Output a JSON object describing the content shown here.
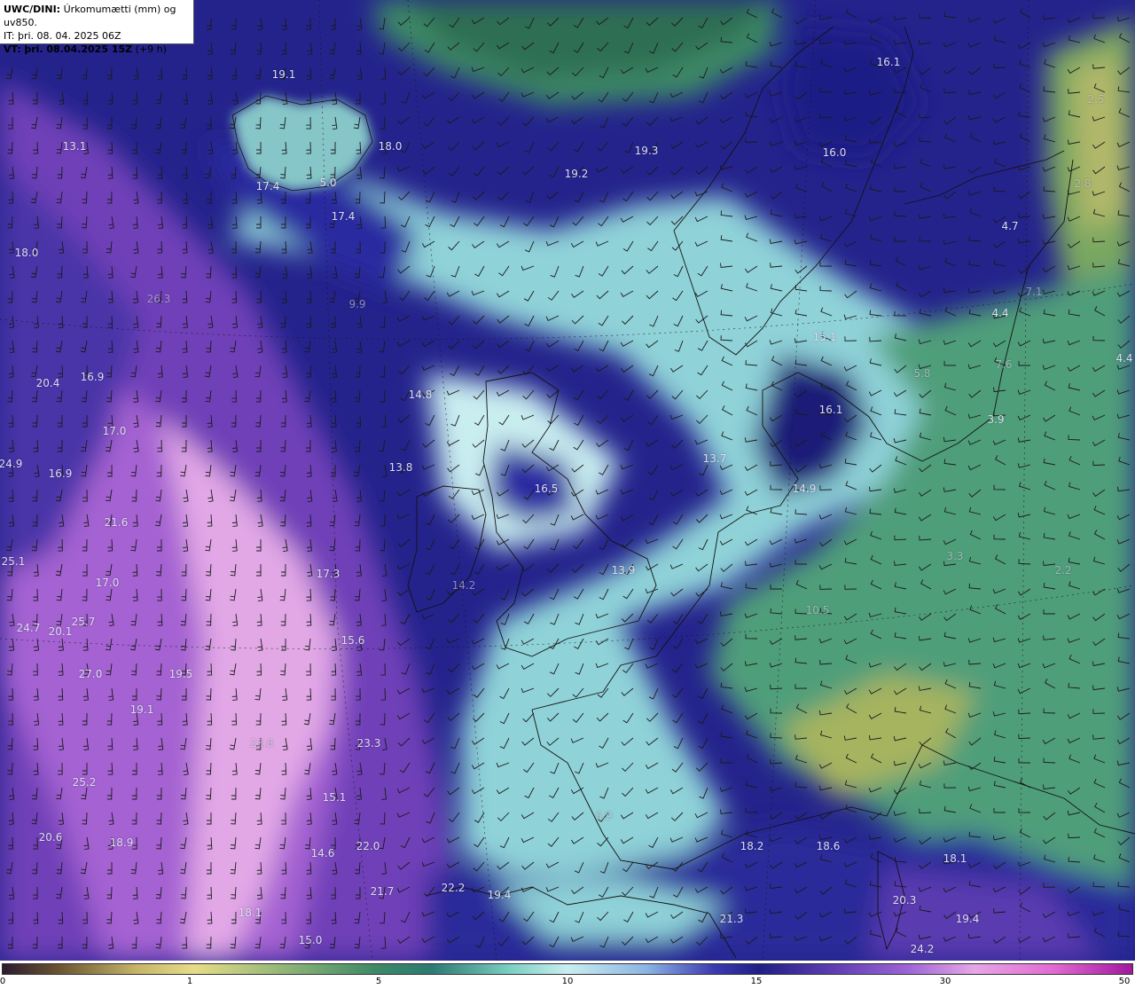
{
  "header": {
    "model": "UWC/DINI:",
    "parameter": "Úrkomumætti (mm) og uv850.",
    "init_time": "IT: þri. 08. 04. 2025 06Z",
    "valid_label": "VT:",
    "valid_time": "þri. 08.04.2025 15Z",
    "lead_time": "(+9 h)"
  },
  "colorbar": {
    "ticks": [
      "0",
      "1",
      "5",
      "10",
      "15",
      "30",
      "50"
    ]
  },
  "values": [
    "19.1",
    "13.1",
    "18.0",
    "17.4",
    "5.0",
    "17.4",
    "18.0",
    "19.3",
    "19.2",
    "16.1",
    "16.0",
    "2.5",
    "2.8",
    "4.7",
    "4.4",
    "7.1",
    "7.6",
    "4.4",
    "3.9",
    "5.8",
    "15.1",
    "16.1",
    "26.3",
    "20.4",
    "16.9",
    "17.0",
    "24.9",
    "16.9",
    "21.6",
    "25.1",
    "17.0",
    "24.7",
    "20.1",
    "25.7",
    "14.8",
    "13.8",
    "16.5",
    "13.7",
    "14.9",
    "14.2",
    "13.9",
    "17.3",
    "15.6",
    "27.0",
    "19.5",
    "19.1",
    "23.8",
    "23.3",
    "25.2",
    "15.1",
    "20.6",
    "18.9",
    "14.6",
    "22.0",
    "21.7",
    "18.1",
    "15.0",
    "22.2",
    "19.4",
    "21.3",
    "18.2",
    "18.6",
    "18.1",
    "20.3",
    "19.4",
    "24.2",
    "3.3",
    "2.2",
    "6.9",
    "9.9",
    "10.5"
  ],
  "colors": {
    "title_bg": "#ffffff",
    "label_text": "#dcdcf0"
  }
}
